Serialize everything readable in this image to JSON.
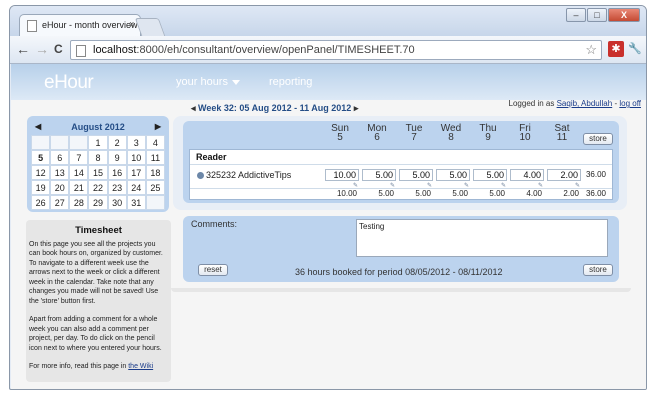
{
  "browser": {
    "tab_title": "eHour - month overview",
    "tab_close": "x",
    "win_min": "–",
    "win_max": "□",
    "win_close": "X",
    "url_host": "localhost",
    "url_rest": ":8000/eh/consultant/overview/openPanel/TIMESHEET.70",
    "back": "←",
    "forward": "→",
    "reload": "C",
    "star": "☆",
    "ext_icon": "✱",
    "wrench_icon": "🔧"
  },
  "header": {
    "logo": "eHour",
    "menu": [
      {
        "label": "your hours"
      },
      {
        "label": "reporting"
      }
    ],
    "logged_in_prefix": "Logged in as",
    "user": "Saqib, Abdullah",
    "sep": "-",
    "logoff": "log off"
  },
  "calendar": {
    "prev": "◆",
    "next": "◆",
    "month": "August 2012",
    "weeks": [
      [
        "",
        "",
        "1",
        "2",
        "3",
        "4"
      ],
      [
        "5",
        "6",
        "7",
        "8",
        "9",
        "10",
        "11"
      ],
      [
        "12",
        "13",
        "14",
        "15",
        "16",
        "17",
        "18"
      ],
      [
        "19",
        "20",
        "21",
        "22",
        "23",
        "24",
        "25"
      ],
      [
        "26",
        "27",
        "28",
        "29",
        "30",
        "31",
        ""
      ]
    ]
  },
  "help": {
    "title": "Timesheet",
    "p1": "On this page you see all the projects you can book hours on, organized by customer. To navigate to a different week use the arrows next to the week or click a different week in the calendar. Take note that any changes you made will not be saved! Use the 'store' button first.",
    "p2": "Apart from adding a comment for a whole week you can also add a comment per project, per day. To do click on the pencil icon next to where you entered your hours.",
    "more_prefix": "For more info, read this page in",
    "wiki_link": "the Wiki"
  },
  "week": {
    "prev": "◆",
    "label": "Week 32: 05 Aug 2012 - 11 Aug 2012",
    "next": "◆"
  },
  "timesheet": {
    "days": [
      {
        "name": "Sun",
        "num": "5"
      },
      {
        "name": "Mon",
        "num": "6"
      },
      {
        "name": "Tue",
        "num": "7"
      },
      {
        "name": "Wed",
        "num": "8"
      },
      {
        "name": "Thu",
        "num": "9"
      },
      {
        "name": "Fri",
        "num": "10"
      },
      {
        "name": "Sat",
        "num": "11"
      }
    ],
    "store": "store",
    "customer": "Reader",
    "project": "325232 AddictiveTips",
    "hours": [
      "10.00",
      "5.00",
      "5.00",
      "5.00",
      "5.00",
      "4.00",
      "2.00"
    ],
    "row_total": "36.00",
    "day_totals": [
      "10.00",
      "5.00",
      "5.00",
      "5.00",
      "5.00",
      "4.00",
      "2.00"
    ],
    "week_total": "36.00",
    "pencil": "✎"
  },
  "comments": {
    "label": "Comments:",
    "text": "Testing",
    "reset": "reset",
    "booked": "36 hours booked for period 08/05/2012 - 08/11/2012",
    "store": "store"
  }
}
